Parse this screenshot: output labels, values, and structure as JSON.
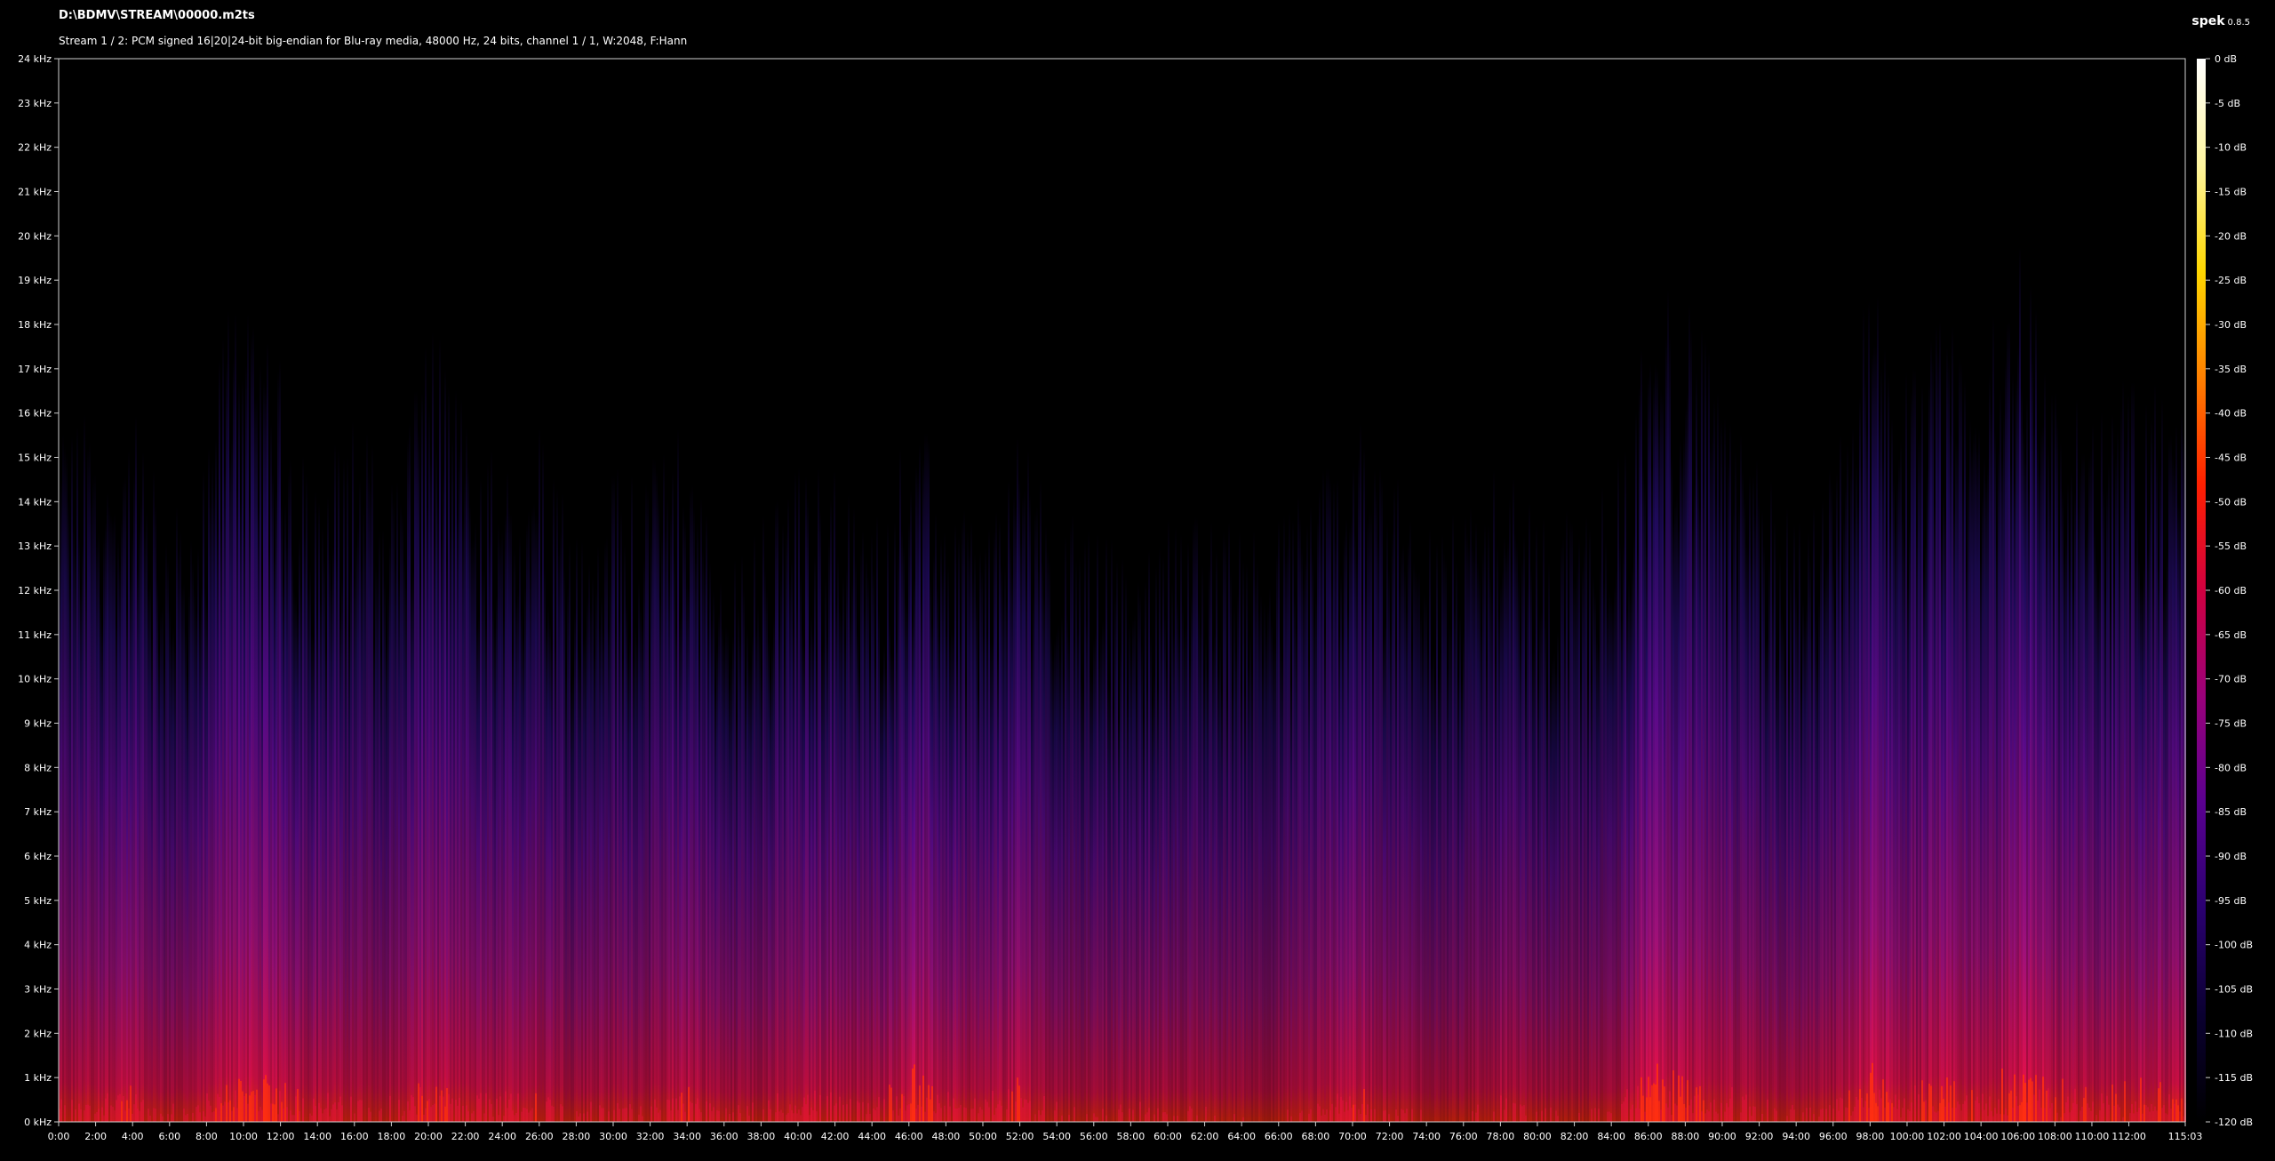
{
  "header": {
    "file_path": "D:\\BDMV\\STREAM\\00000.m2ts",
    "stream_info": "Stream 1 / 2: PCM signed 16|20|24-bit big-endian for Blu-ray media, 48000 Hz, 24 bits, channel 1 / 1, W:2048, F:Hann"
  },
  "brand": {
    "name": "spek",
    "version": "0.8.5"
  },
  "chart_data": {
    "type": "heatmap",
    "title": "",
    "xlabel": "",
    "ylabel": "",
    "x_range": [
      "0:00",
      "115:03"
    ],
    "x_max_minutes": 115.05,
    "x_ticks": [
      "0:00",
      "2:00",
      "4:00",
      "6:00",
      "8:00",
      "10:00",
      "12:00",
      "14:00",
      "16:00",
      "18:00",
      "20:00",
      "22:00",
      "24:00",
      "26:00",
      "28:00",
      "30:00",
      "32:00",
      "34:00",
      "36:00",
      "38:00",
      "40:00",
      "42:00",
      "44:00",
      "46:00",
      "48:00",
      "50:00",
      "52:00",
      "54:00",
      "56:00",
      "58:00",
      "60:00",
      "62:00",
      "64:00",
      "66:00",
      "68:00",
      "70:00",
      "72:00",
      "74:00",
      "76:00",
      "78:00",
      "80:00",
      "82:00",
      "84:00",
      "86:00",
      "88:00",
      "90:00",
      "92:00",
      "94:00",
      "96:00",
      "98:00",
      "100:00",
      "102:00",
      "104:00",
      "106:00",
      "108:00",
      "110:00",
      "112:00",
      "115:03"
    ],
    "y_range_khz": [
      0,
      24
    ],
    "y_ticks": [
      "0 kHz",
      "1 kHz",
      "2 kHz",
      "3 kHz",
      "4 kHz",
      "5 kHz",
      "6 kHz",
      "7 kHz",
      "8 kHz",
      "9 kHz",
      "10 kHz",
      "11 kHz",
      "12 kHz",
      "13 kHz",
      "14 kHz",
      "15 kHz",
      "16 kHz",
      "17 kHz",
      "18 kHz",
      "19 kHz",
      "20 kHz",
      "21 kHz",
      "22 kHz",
      "23 kHz",
      "24 kHz"
    ],
    "colorbar": {
      "range_db": [
        -120,
        0
      ],
      "ticks": [
        "0 dB",
        "-5 dB",
        "-10 dB",
        "-15 dB",
        "-20 dB",
        "-25 dB",
        "-30 dB",
        "-35 dB",
        "-40 dB",
        "-45 dB",
        "-50 dB",
        "-55 dB",
        "-60 dB",
        "-65 dB",
        "-70 dB",
        "-75 dB",
        "-80 dB",
        "-85 dB",
        "-90 dB",
        "-95 dB",
        "-100 dB",
        "-105 dB",
        "-110 dB",
        "-115 dB",
        "-120 dB"
      ],
      "colors": [
        "#ffffff",
        "#fff6a0",
        "#ffd700",
        "#ff8000",
        "#ff2000",
        "#d00040",
        "#9a007a",
        "#5a0090",
        "#2a0070",
        "#0a0030",
        "#000000"
      ]
    },
    "intensity_profile": {
      "time_minutes": [
        0,
        2,
        4,
        6,
        8,
        9.5,
        10,
        12,
        14,
        16,
        18,
        20,
        22,
        24,
        26,
        28,
        30,
        32,
        34,
        36,
        38,
        40,
        42,
        44,
        46,
        48,
        50,
        52,
        54,
        56,
        58,
        60,
        62,
        64,
        66,
        68,
        70,
        72,
        74,
        76,
        78,
        80,
        82,
        84,
        86,
        88,
        90,
        92,
        94,
        96,
        98,
        100,
        102,
        104,
        106,
        108,
        110,
        112,
        115
      ],
      "level": [
        0.55,
        0.62,
        0.68,
        0.5,
        0.58,
        0.8,
        0.82,
        0.7,
        0.6,
        0.6,
        0.55,
        0.72,
        0.6,
        0.6,
        0.65,
        0.52,
        0.55,
        0.55,
        0.68,
        0.5,
        0.55,
        0.6,
        0.65,
        0.55,
        0.82,
        0.65,
        0.55,
        0.72,
        0.5,
        0.5,
        0.5,
        0.52,
        0.5,
        0.45,
        0.45,
        0.55,
        0.7,
        0.52,
        0.5,
        0.45,
        0.6,
        0.5,
        0.45,
        0.5,
        0.82,
        0.72,
        0.62,
        0.55,
        0.5,
        0.55,
        0.82,
        0.62,
        0.72,
        0.62,
        0.86,
        0.68,
        0.62,
        0.72,
        0.68
      ],
      "max_khz": [
        14,
        14,
        14,
        12,
        13,
        18,
        16,
        15,
        13,
        14,
        13,
        16,
        14,
        13,
        14,
        12,
        13,
        13,
        14,
        11,
        12,
        13,
        13,
        12,
        14,
        13,
        12,
        14,
        12,
        12,
        11,
        12,
        12,
        12,
        12,
        13,
        14,
        13,
        12,
        12,
        13,
        12,
        12,
        13,
        16,
        17,
        14,
        13,
        12,
        13,
        17,
        15,
        16,
        15,
        18,
        15,
        14,
        15,
        14
      ]
    }
  }
}
